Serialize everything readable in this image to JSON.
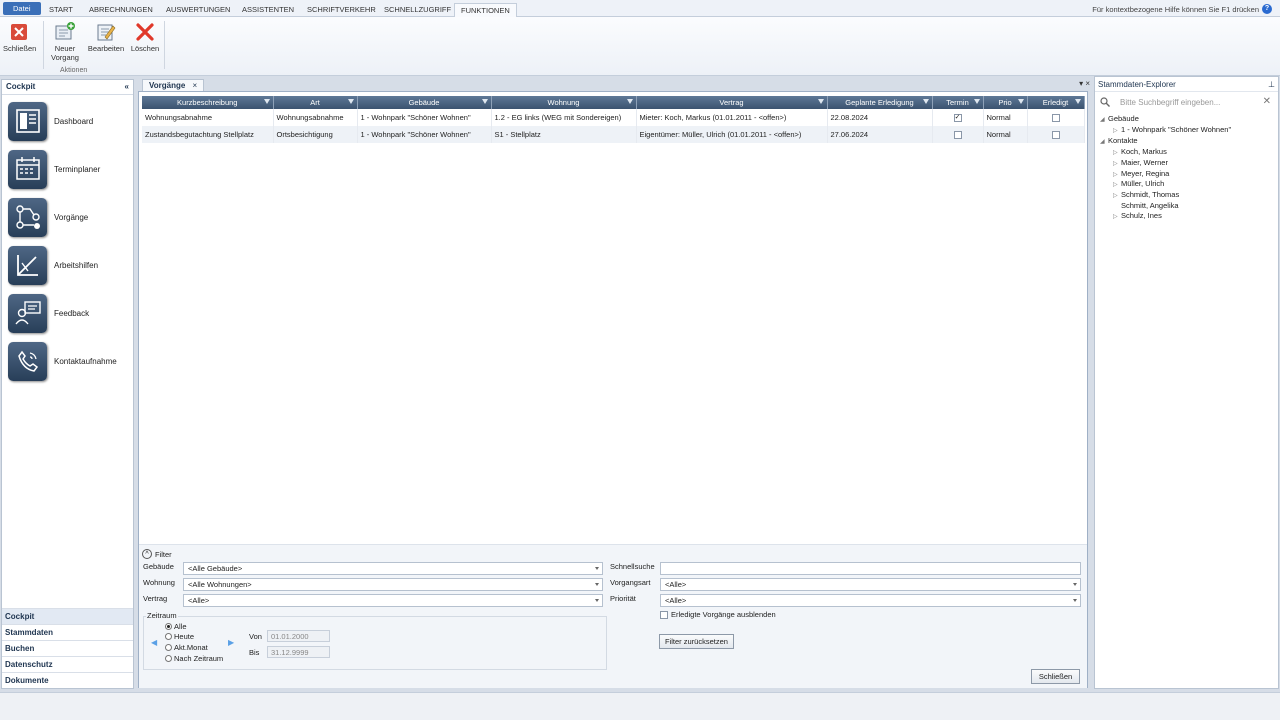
{
  "ribbon_tabs": [
    "Datei",
    "START",
    "ABRECHNUNGEN",
    "AUSWERTUNGEN",
    "ASSISTENTEN",
    "SCHRIFTVERKEHR",
    "SCHNELLZUGRIFF",
    "FUNKTIONEN"
  ],
  "help_text": "Für kontextbezogene Hilfe können Sie F1 drücken",
  "ribbon": {
    "close": "Schließen",
    "new_line1": "Neuer",
    "new_line2": "Vorgang",
    "edit": "Bearbeiten",
    "delete": "Löschen",
    "group": "Aktionen"
  },
  "cockpit": {
    "title": "Cockpit",
    "collapse_glyph": "«",
    "items": [
      "Dashboard",
      "Terminplaner",
      "Vorgänge",
      "Arbeitshilfen",
      "Feedback",
      "Kontaktaufnahme"
    ],
    "sections": [
      "Cockpit",
      "Stammdaten",
      "Buchen",
      "Datenschutz",
      "Dokumente"
    ]
  },
  "doc": {
    "tab": "Vorgänge",
    "tab_close": "×",
    "tools": "▾ ×"
  },
  "table": {
    "headers": [
      "Kurzbeschreibung",
      "Art",
      "Gebäude",
      "Wohnung",
      "Vertrag",
      "Geplante Erledigung",
      "Termin",
      "Prio",
      "Erledigt"
    ],
    "rows": [
      {
        "kurz": "Wohnungsabnahme",
        "art": "Wohnungsabnahme",
        "gebaeude": "1 - Wohnpark \"Schöner Wohnen\"",
        "wohnung": "1.2 - EG links (WEG mit Sondereigen)",
        "vertrag": "Mieter: Koch, Markus (01.01.2011 - <offen>)",
        "datum": "22.08.2024",
        "termin": "✓",
        "prio": "Normal",
        "erledigt": ""
      },
      {
        "kurz": "Zustandsbegutachtung Stellplatz",
        "art": "Ortsbesichtigung",
        "gebaeude": "1 - Wohnpark \"Schöner Wohnen\"",
        "wohnung": "S1 - Stellplatz",
        "vertrag": "Eigentümer: Müller, Ulrich (01.01.2011 - <offen>)",
        "datum": "27.06.2024",
        "termin": "",
        "prio": "Normal",
        "erledigt": ""
      }
    ]
  },
  "filter": {
    "toggle": "Filter",
    "toggle_glyph": "^",
    "gebaeude_label": "Gebäude",
    "gebaeude_value": "<Alle Gebäude>",
    "wohnung_label": "Wohnung",
    "wohnung_value": "<Alle Wohnungen>",
    "vertrag_label": "Vertrag",
    "vertrag_value": "<Alle>",
    "schnellsuche_label": "Schnellsuche",
    "schnellsuche_value": "",
    "vorgangsart_label": "Vorgangsart",
    "vorgangsart_value": "<Alle>",
    "prioritaet_label": "Priorität",
    "prioritaet_value": "<Alle>",
    "erledigte_label": "Erledigte Vorgänge ausblenden",
    "zeitraum_label": "Zeitraum",
    "prev_glyph": "◀",
    "next_glyph": "▶",
    "zeitraum_options": [
      "Alle",
      "Heute",
      "Akt.Monat",
      "Nach Zeitraum"
    ],
    "von_label": "Von",
    "von_value": "01.01.2000",
    "bis_label": "Bis",
    "bis_value": "31.12.9999",
    "reset_button": "Filter zurücksetzen",
    "close_button": "Schließen"
  },
  "explorer": {
    "title": "Stammdaten-Explorer",
    "pin_glyph": "⊥",
    "search_placeholder": "Bitte Suchbegriff eingeben...",
    "clear_glyph": "✕",
    "expand_open": "◢",
    "expand_closed": "▷",
    "gebaeude": "Gebäude",
    "gebaeude_items": [
      "1 - Wohnpark \"Schöner Wohnen\""
    ],
    "kontakte": "Kontakte",
    "kontakte_items": [
      "Koch, Markus",
      "Maier, Werner",
      "Meyer, Regina",
      "Müller, Ulrich",
      "Schmidt, Thomas",
      "Schmitt, Angelika",
      "Schulz, Ines"
    ]
  }
}
